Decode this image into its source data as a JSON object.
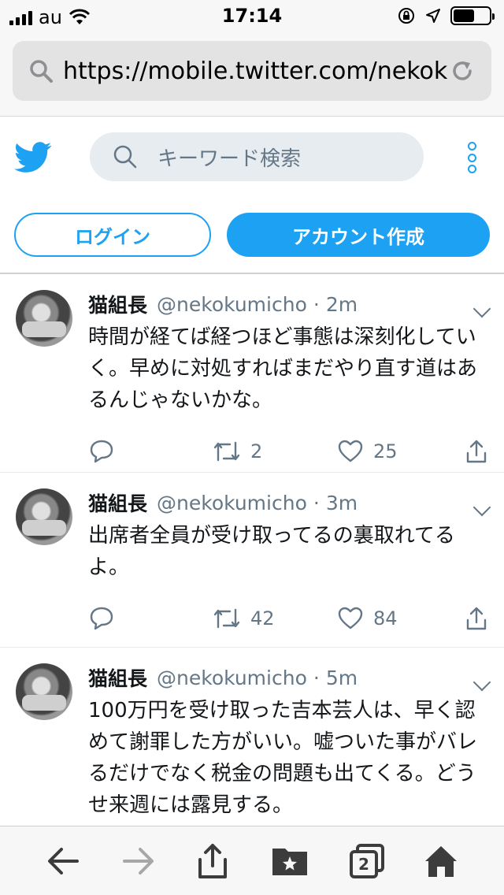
{
  "status_bar": {
    "carrier": "au",
    "time": "17:14"
  },
  "browser": {
    "url": "https://mobile.twitter.com/nekok…",
    "tab_count": "2"
  },
  "header": {
    "search_placeholder": "キーワード検索",
    "login_label": "ログイン",
    "signup_label": "アカウント作成"
  },
  "tweets": [
    {
      "name": "猫組長",
      "handle": "@nekokumicho",
      "time": "2m",
      "text": "時間が経てば経つほど事態は深刻化していく。早めに対処すればまだやり直す道はあるんじゃないかな。",
      "retweets": "2",
      "likes": "25"
    },
    {
      "name": "猫組長",
      "handle": "@nekokumicho",
      "time": "3m",
      "text": "出席者全員が受け取ってるの裏取れてるよ。",
      "retweets": "42",
      "likes": "84"
    },
    {
      "name": "猫組長",
      "handle": "@nekokumicho",
      "time": "5m",
      "text": "100万円を受け取った吉本芸人は、早く認めて謝罪した方がいい。嘘ついた事がバレるだけでなく税金の問題も出てくる。どうせ来週には露見する。",
      "retweets": "",
      "likes": ""
    }
  ],
  "colors": {
    "accent": "#1da1f2",
    "muted": "#657786"
  }
}
